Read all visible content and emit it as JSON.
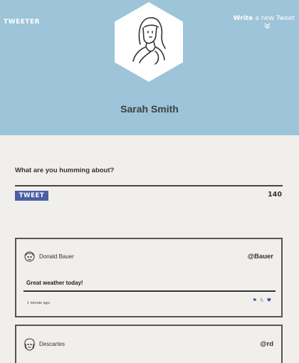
{
  "header": {
    "brand": "TWEETER",
    "write_prefix": "Write",
    "write_suffix": " a new Tweet",
    "profile_name": "Sarah Smith",
    "background_color": "#9dc4d8"
  },
  "compose": {
    "prompt": "What are you humming about?",
    "tweet_button_label": "TWEET",
    "char_count": "140",
    "button_color": "#4a5ea3"
  },
  "tweets": [
    {
      "display_name": "Donald Bauer",
      "handle": "@Bauer",
      "text": "Great weather today!",
      "time": "1 minute ago",
      "icons": [
        "flag-icon",
        "retweet-icon",
        "heart-icon"
      ]
    },
    {
      "display_name": "Descartes",
      "handle": "@rd"
    }
  ]
}
